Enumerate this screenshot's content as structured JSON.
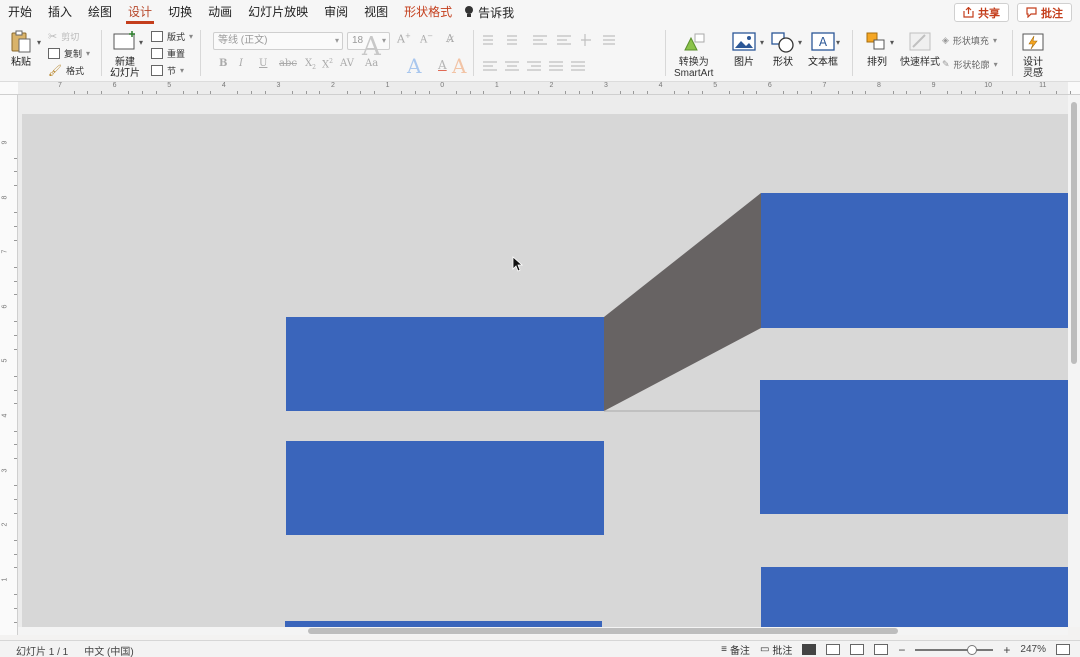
{
  "menu": {
    "tabs": [
      "开始",
      "插入",
      "绘图",
      "设计",
      "切换",
      "动画",
      "幻灯片放映",
      "审阅",
      "视图",
      "形状格式"
    ],
    "active_tab": "设计",
    "tell_me": "告诉我"
  },
  "actions": {
    "share": "共享",
    "comments": "批注"
  },
  "ribbon": {
    "paste": "粘贴",
    "cut": "剪切",
    "copy": "复制",
    "format": "格式",
    "new_slide_line1": "新建",
    "new_slide_line2": "幻灯片",
    "layout": "版式",
    "reset": "重置",
    "section": "节",
    "font_name_placeholder": "等线 (正文)",
    "font_size": "18",
    "convert_smartart_line1": "转换为",
    "convert_smartart_line2": "SmartArt",
    "picture": "图片",
    "shapes": "形状",
    "textbox": "文本框",
    "arrange": "排列",
    "quick_styles": "快速样式",
    "shape_fill": "形状填充",
    "shape_outline": "形状轮廓",
    "design_ideas_line1": "设计",
    "design_ideas_line2": "灵感"
  },
  "ruler": {
    "h_labels": [
      "7",
      "6",
      "5",
      "4",
      "3",
      "2",
      "1",
      "0",
      "1",
      "2",
      "3",
      "4",
      "5",
      "6",
      "7",
      "8",
      "9",
      "10",
      "11"
    ],
    "v_labels": [
      "9",
      "8",
      "7",
      "6",
      "5",
      "4",
      "3",
      "2",
      "1"
    ]
  },
  "status": {
    "slide_indicator": "幻灯片 1 / 1",
    "language": "中文 (中国)",
    "notes": "备注",
    "comments": "批注",
    "zoom": "247%"
  },
  "colors": {
    "shape_blue": "#3a65bb",
    "connector_gray": "#676363",
    "slide_bg": "#d7d7d7",
    "accent": "#c43e1c"
  }
}
